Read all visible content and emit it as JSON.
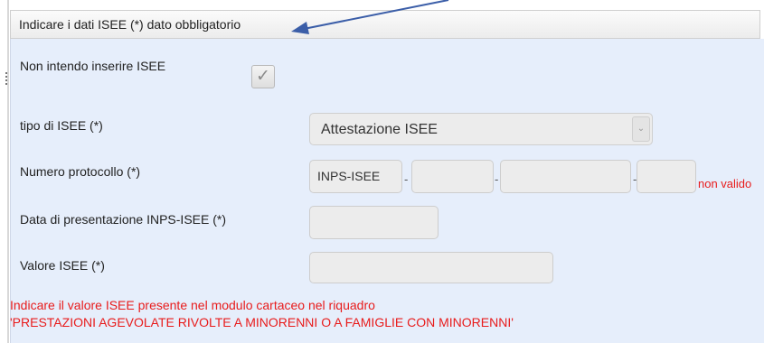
{
  "section": {
    "title": "Indicare i dati ISEE (*) dato obbligatorio"
  },
  "form": {
    "no_isee": {
      "label": "Non intendo inserire ISEE",
      "checked": true,
      "check_glyph": "✓"
    },
    "tipo_isee": {
      "label": "tipo di ISEE (*)",
      "value": "Attestazione ISEE",
      "dropdown_icon": "chevron-down-icon",
      "dropdown_glyph": "⌄"
    },
    "protocollo": {
      "label": "Numero protocollo (*)",
      "prefix": "INPS-ISEE",
      "separator": "-",
      "part1": "",
      "part2": "",
      "part3": "",
      "error": "non valido"
    },
    "data_presentazione": {
      "label": "Data di presentazione INPS-ISEE (*)",
      "value": ""
    },
    "valore": {
      "label": "Valore ISEE (*)",
      "value": ""
    }
  },
  "notes": {
    "line1": "Indicare il valore ISEE presente nel modulo cartaceo nel riquadro",
    "line2": "'PRESTAZIONI AGEVOLATE RIVOLTE A MINORENNI O A FAMIGLIE CON MINORENNI'"
  },
  "colors": {
    "panel_bg": "#e6eefb",
    "error_red": "#e81c1c",
    "annotation_arrow": "#3b5ea8"
  }
}
